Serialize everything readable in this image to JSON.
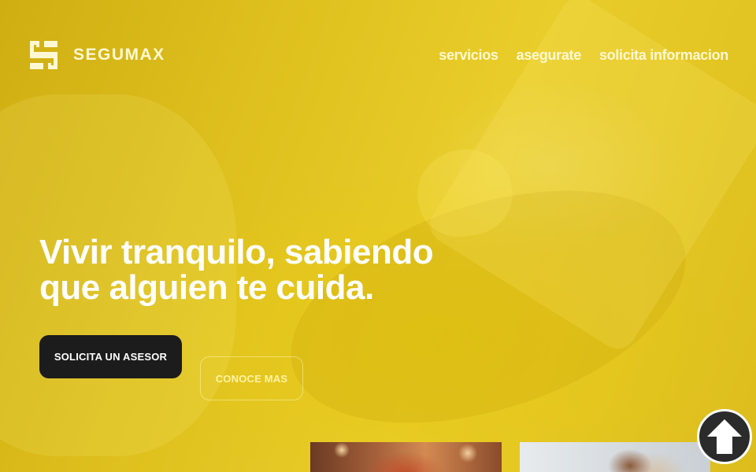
{
  "brand": {
    "name": "SEGUMAX",
    "logo_icon": "segumax-s-logo-icon"
  },
  "nav": {
    "items": [
      {
        "label": "servicios"
      },
      {
        "label": "asegurate"
      },
      {
        "label": "solicita informacion"
      }
    ]
  },
  "hero": {
    "headline_line1": "Vivir tranquilo, sabiendo",
    "headline_line2": "que alguien te cuida.",
    "primary_button": "SOLICITA UN ASESOR",
    "secondary_button": "CONOCE MAS",
    "background_tint": "#e2c51f"
  },
  "cards": [
    {
      "icon": "photo-people-warm"
    },
    {
      "icon": "photo-person-office"
    }
  ],
  "scroll_top": {
    "icon": "arrow-up-icon"
  },
  "colors": {
    "primary_button_bg": "#1c1c1c",
    "text_light": "#ffffff",
    "nav_text": "#fff8d2"
  }
}
